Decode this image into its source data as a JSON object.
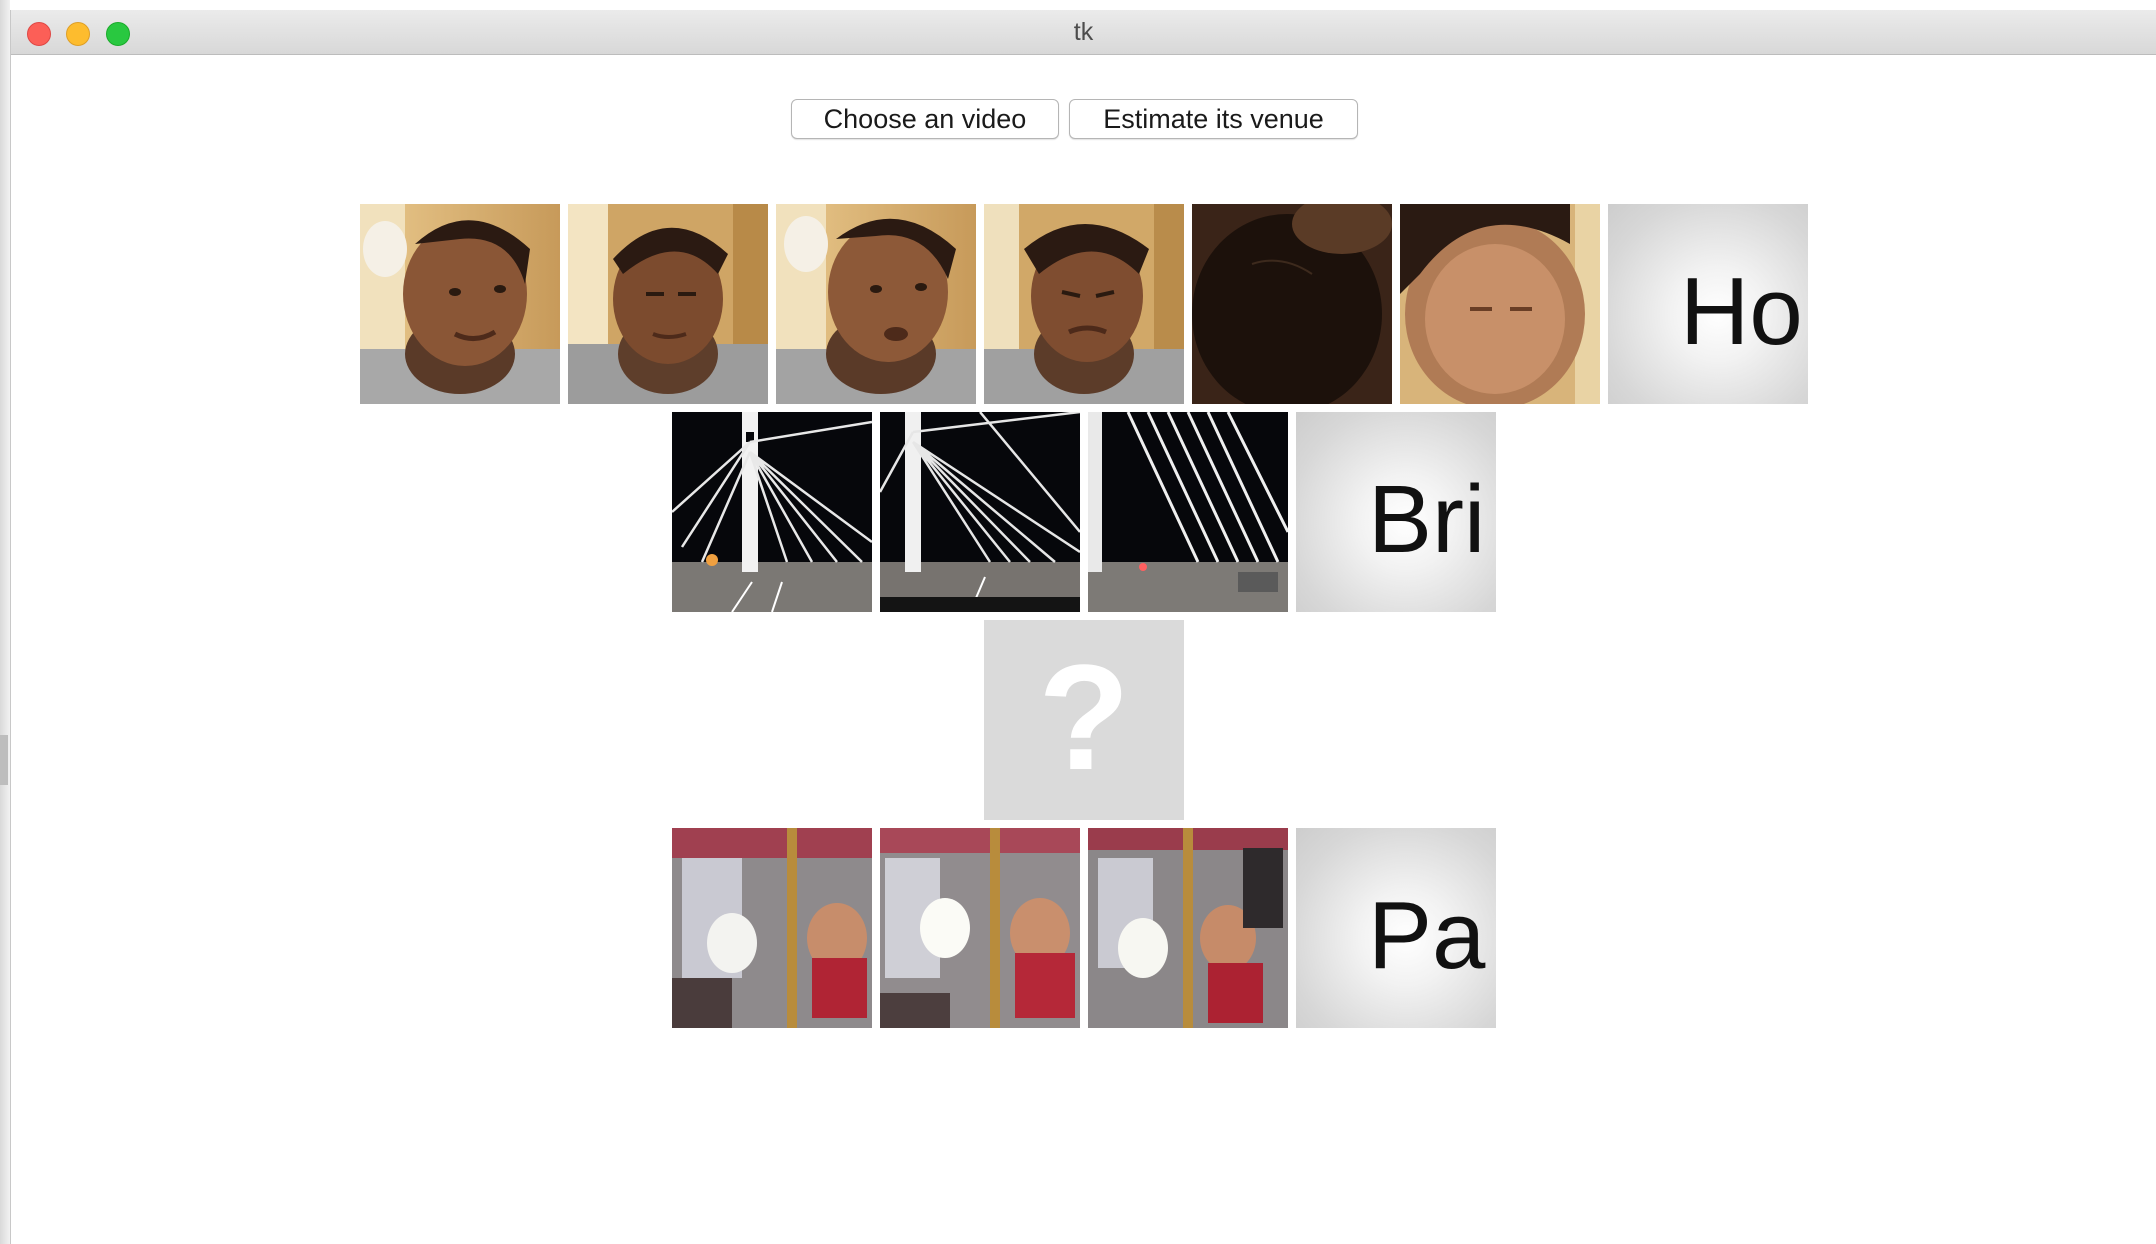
{
  "window": {
    "title": "tk"
  },
  "toolbar": {
    "choose_label": "Choose an video",
    "estimate_label": "Estimate its venue"
  },
  "rows": [
    {
      "frames": [
        "face",
        "face",
        "face",
        "face",
        "face-dark",
        "face-blur"
      ],
      "label": "Ho"
    },
    {
      "frames": [
        "bridge",
        "bridge",
        "bridge"
      ],
      "label": "Bri"
    },
    {
      "frames": [],
      "label": "?"
    },
    {
      "frames": [
        "carousel",
        "carousel",
        "carousel"
      ],
      "label": "Pa"
    }
  ],
  "colors": {
    "close": "#fc5f57",
    "minimize": "#fdbc2e",
    "maximize": "#29c840",
    "unknown_tile": "#dadada"
  },
  "icons": [
    "close-icon",
    "minimize-icon",
    "maximize-icon",
    "question-mark-icon"
  ]
}
